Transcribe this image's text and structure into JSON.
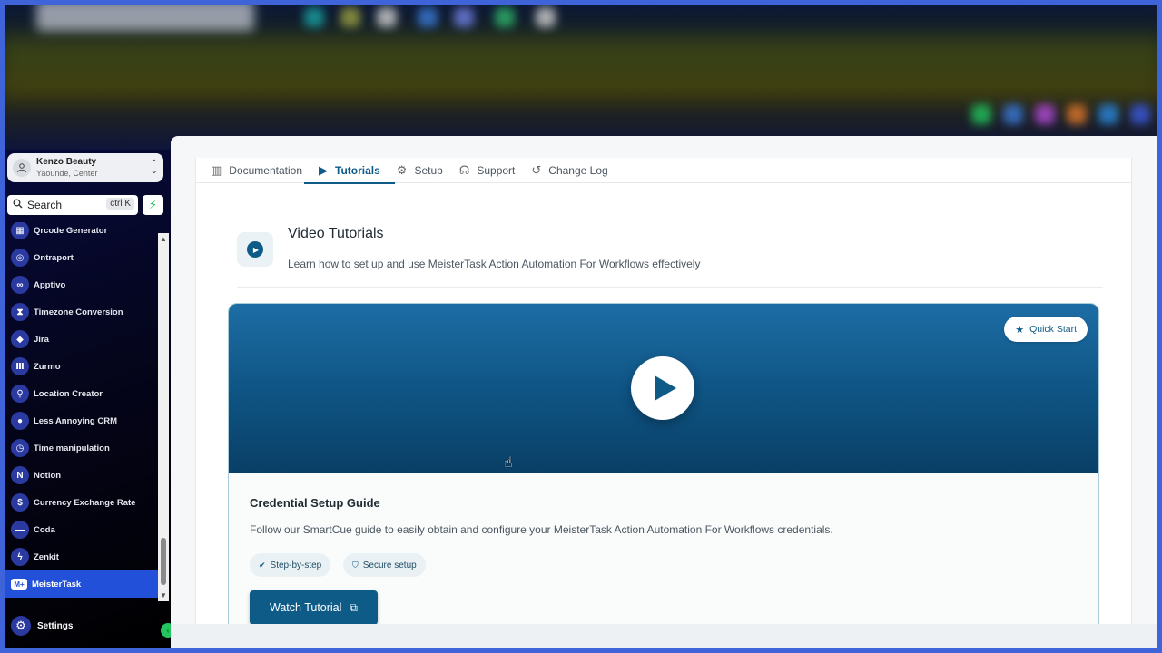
{
  "account": {
    "name": "Kenzo Beauty",
    "location": "Yaounde, Center"
  },
  "search": {
    "label": "Search",
    "shortcut": "ctrl K"
  },
  "sidebar": {
    "items": [
      {
        "label": "Qrcode Generator",
        "icon": "qrcode-icon"
      },
      {
        "label": "Ontraport",
        "icon": "ontraport-icon"
      },
      {
        "label": "Apptivo",
        "icon": "apptivo-icon"
      },
      {
        "label": "Timezone Conversion",
        "icon": "hourglass-icon"
      },
      {
        "label": "Jira",
        "icon": "jira-icon"
      },
      {
        "label": "Zurmo",
        "icon": "zurmo-icon"
      },
      {
        "label": "Location Creator",
        "icon": "pin-icon"
      },
      {
        "label": "Less Annoying CRM",
        "icon": "user-icon"
      },
      {
        "label": "Time manipulation",
        "icon": "clock-icon"
      },
      {
        "label": "Notion",
        "icon": "notion-icon"
      },
      {
        "label": "Currency Exchange Rate",
        "icon": "currency-icon"
      },
      {
        "label": "Coda",
        "icon": "coda-icon"
      },
      {
        "label": "Zenkit",
        "icon": "bolt-icon"
      },
      {
        "label": "MeisterTask",
        "icon": "meistertask-icon",
        "badge": "M+"
      }
    ],
    "settings_label": "Settings"
  },
  "tabs": [
    {
      "label": "Documentation",
      "icon": "book-icon"
    },
    {
      "label": "Tutorials",
      "icon": "play-circle-icon",
      "active": true
    },
    {
      "label": "Setup",
      "icon": "gear-icon"
    },
    {
      "label": "Support",
      "icon": "headset-icon"
    },
    {
      "label": "Change Log",
      "icon": "history-icon"
    }
  ],
  "header": {
    "title": "Video Tutorials",
    "subtitle": "Learn how to set up and use MeisterTask Action Automation For Workflows effectively"
  },
  "card": {
    "badge": "Quick Start",
    "title": "Credential Setup Guide",
    "description": "Follow our SmartCue guide to easily obtain and configure your MeisterTask Action Automation For Workflows credentials.",
    "chips": [
      "Step-by-step",
      "Secure setup"
    ],
    "button": "Watch Tutorial"
  },
  "colors": {
    "accent": "#0f5b87",
    "sidebar_active": "#2250d8",
    "green": "#22c55e"
  }
}
